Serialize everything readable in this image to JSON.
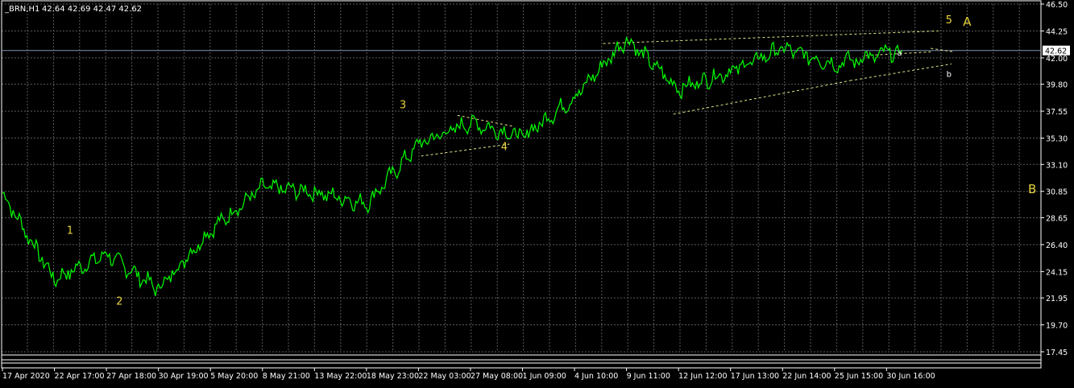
{
  "header": {
    "symbol": "_BRN,H1",
    "ohlc": "42.64 42.69 42.47 42.62"
  },
  "colors": {
    "background": "#000000",
    "price_line": "#00ff00",
    "grid": "#5a5a5a",
    "axis_text": "#ffffff",
    "wave_label": "#e6d23c",
    "trend_line": "#e6e68c",
    "current_price_line": "#7f93ad"
  },
  "chart_data": {
    "type": "line",
    "title": "",
    "xlabel": "",
    "ylabel": "",
    "ylim": [
      17.45,
      46.5
    ],
    "y_ticks": [
      "46.50",
      "44.25",
      "42.00",
      "39.80",
      "37.55",
      "35.30",
      "33.10",
      "30.85",
      "28.65",
      "26.40",
      "24.15",
      "21.95",
      "19.70",
      "17.45"
    ],
    "y_tick_values": [
      46.5,
      44.25,
      42.0,
      39.8,
      37.55,
      35.3,
      33.1,
      30.85,
      28.65,
      26.4,
      24.15,
      21.95,
      19.7,
      17.45
    ],
    "x_labels": [
      "17 Apr 2020",
      "22 Apr 17:00",
      "27 Apr 18:00",
      "30 Apr 19:00",
      "5 May 20:00",
      "8 May 21:00",
      "13 May 22:00",
      "18 May 23:00",
      "22 May 03:00",
      "27 May 08:00",
      "1 Jun 09:00",
      "4 Jun 10:00",
      "9 Jun 11:00",
      "12 Jun 12:00",
      "17 Jun 13:00",
      "22 Jun 14:00",
      "25 Jun 15:00",
      "30 Jun 16:00"
    ],
    "current_price": 42.62,
    "current_price_label": "42.62",
    "grid": true,
    "legend": "none",
    "series": [
      {
        "x": [
          0,
          1,
          2,
          3,
          4,
          5,
          6,
          7,
          8,
          9,
          10,
          11,
          12,
          13,
          14,
          15,
          16,
          17.3
        ],
        "values": [
          30.7,
          23.5,
          25.6,
          22.7,
          27.6,
          31.2,
          30.8,
          29.8,
          34.8,
          36.6,
          35.4,
          38.7,
          43.6,
          39.4,
          40.9,
          42.8,
          41.5,
          42.62
        ]
      }
    ],
    "wave_labels": [
      {
        "text": "1",
        "x": 1.3,
        "y": 27.3
      },
      {
        "text": "2",
        "x": 2.25,
        "y": 21.4
      },
      {
        "text": "3",
        "x": 7.7,
        "y": 37.8
      },
      {
        "text": "4",
        "x": 9.65,
        "y": 34.3
      },
      {
        "text": "5",
        "x": 18.2,
        "y": 44.9
      },
      {
        "text": "A",
        "x": 18.55,
        "y": 44.7
      },
      {
        "text": "B",
        "x": 19.8,
        "y": 30.7
      },
      {
        "text": "a",
        "x": 17.25,
        "y": 42.2
      },
      {
        "text": "b",
        "x": 18.2,
        "y": 40.4
      }
    ],
    "trend_lines": [
      {
        "x1": 8.05,
        "y1": 33.8,
        "x2": 9.75,
        "y2": 34.8
      },
      {
        "x1": 8.75,
        "y1": 37.2,
        "x2": 9.8,
        "y2": 36.3
      },
      {
        "x1": 11.55,
        "y1": 43.2,
        "x2": 18.0,
        "y2": 44.25
      },
      {
        "x1": 12.9,
        "y1": 37.3,
        "x2": 16.3,
        "y2": 40.1
      },
      {
        "x1": 16.3,
        "y1": 40.1,
        "x2": 18.25,
        "y2": 41.5
      },
      {
        "x1": 16.6,
        "y1": 42.2,
        "x2": 17.85,
        "y2": 42.5
      },
      {
        "x1": 17.85,
        "y1": 42.8,
        "x2": 18.3,
        "y2": 42.5
      }
    ]
  }
}
